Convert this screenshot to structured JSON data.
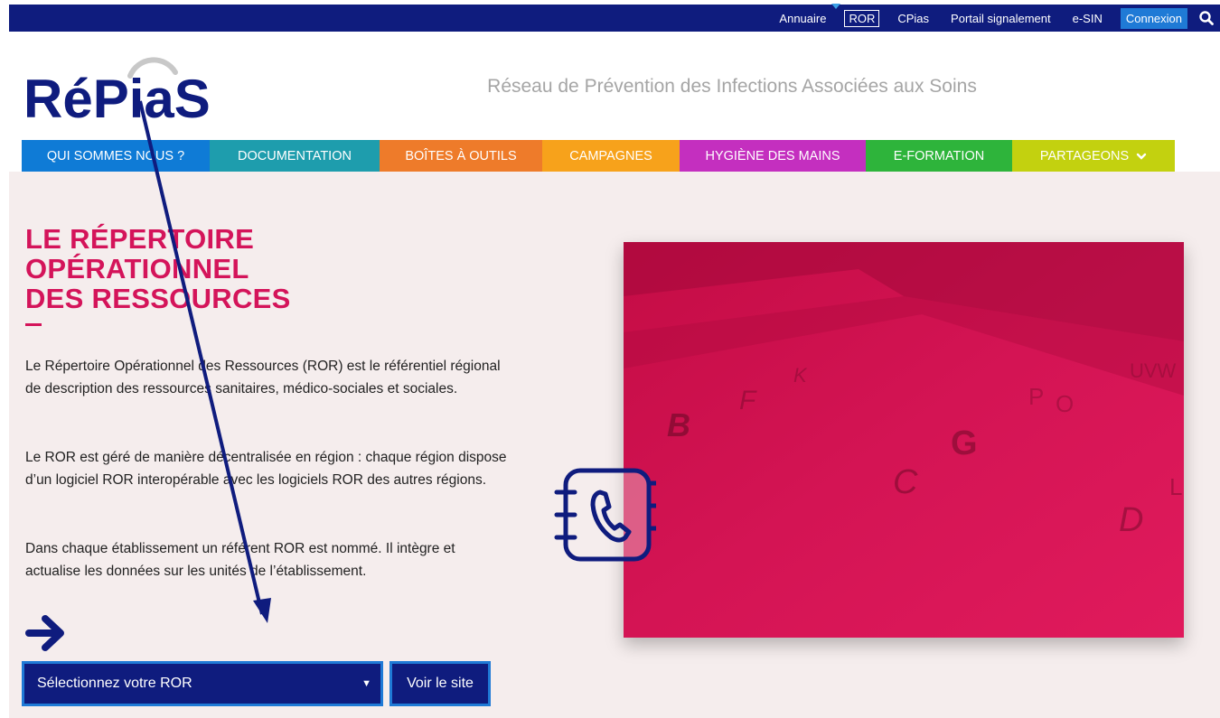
{
  "topbar": {
    "links": [
      "Annuaire",
      "ROR",
      "CPias",
      "Portail signalement",
      "e-SIN"
    ],
    "connexion": "Connexion",
    "search_icon": "search-icon"
  },
  "header": {
    "logo_text": "RéPiaS",
    "tagline": "Réseau de Prévention des Infections Associées aux Soins"
  },
  "nav": {
    "items": [
      {
        "label": "QUI SOMMES NOUS ?",
        "color": "#0f7bd6"
      },
      {
        "label": "DOCUMENTATION",
        "color": "#1e9dad"
      },
      {
        "label": "BOÎTES À OUTILS",
        "color": "#ee7b2a"
      },
      {
        "label": "CAMPAGNES",
        "color": "#f7a21b"
      },
      {
        "label": "HYGIÈNE DES MAINS",
        "color": "#c42fbf"
      },
      {
        "label": "E-FORMATION",
        "color": "#2eb43b"
      },
      {
        "label": "PARTAGEONS",
        "color": "#c3d10f"
      }
    ]
  },
  "main": {
    "title_lines": [
      "LE RÉPERTOIRE",
      "OPÉRATIONNEL",
      "DES RESSOURCES"
    ],
    "paragraphs": [
      "Le Répertoire Opérationnel des Ressources (ROR) est le référentiel régional de description des ressources sanitaires, médico-sociales et sociales.",
      "Le ROR est géré de manière décentralisée en région : chaque région dispose d’un logiciel ROR interopérable avec les logiciels ROR des autres régions.",
      "Dans chaque établissement un référent ROR est nommé. Il intègre et actualise les données sur les unités de l’établissement."
    ],
    "select_value": "Sélectionnez votre ROR",
    "visit_button": "Voir le site",
    "photo_letters": [
      "B",
      "F",
      "K",
      "C",
      "G",
      "P",
      "O",
      "D",
      "L",
      "UVW"
    ]
  },
  "colors": {
    "brand_blue": "#0f1c7e",
    "accent_blue": "#1f7ad6",
    "title_pink": "#d4145a",
    "photo_red": "#d1104f"
  }
}
